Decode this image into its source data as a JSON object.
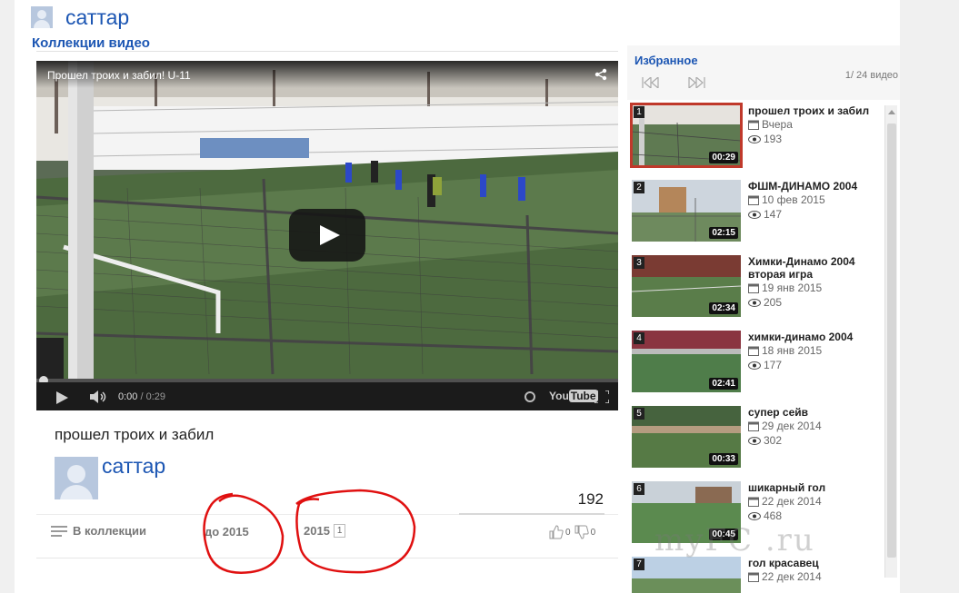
{
  "header": {
    "user_name": "саттар",
    "section_title": "Коллекции видео"
  },
  "player": {
    "title": "Прошел троих и забил! U-11",
    "time_current": "0:00",
    "time_separator": " / ",
    "time_total": "0:29",
    "logo_you": "You",
    "logo_tube": "Tube",
    "progress": 0
  },
  "video": {
    "title": "прошел троих и забил",
    "author": "саттар",
    "views": "192",
    "collections_label": "В коллекции",
    "tag_before": "до 2015",
    "tag_year": "2015",
    "tag_year_count": "1",
    "likes": "0",
    "dislikes": "0"
  },
  "sidebar": {
    "title": "Избранное",
    "counter": "1/ 24 видео",
    "items": [
      {
        "num": "1",
        "duration": "00:29",
        "title": "прошел троих и забил",
        "date": "Вчера",
        "views": "193"
      },
      {
        "num": "2",
        "duration": "02:15",
        "title": "ФШМ-ДИНАМО 2004",
        "date": "10 фев 2015",
        "views": "147"
      },
      {
        "num": "3",
        "duration": "02:34",
        "title": "Химки-Динамо 2004 вторая игра",
        "date": "19 янв 2015",
        "views": "205"
      },
      {
        "num": "4",
        "duration": "02:41",
        "title": "химки-динамо 2004",
        "date": "18 янв 2015",
        "views": "177"
      },
      {
        "num": "5",
        "duration": "00:33",
        "title": "супер сейв",
        "date": "29 дек 2014",
        "views": "302"
      },
      {
        "num": "6",
        "duration": "00:45",
        "title": "шикарный гол",
        "date": "22 дек 2014",
        "views": "468"
      },
      {
        "num": "7",
        "duration": "",
        "title": "гол красавец",
        "date": "22 дек 2014",
        "views": ""
      }
    ]
  },
  "watermark": "myFC .ru",
  "colors": {
    "link": "#1c56b3",
    "annotation": "#e01010",
    "active_thumb_border": "#c0392b"
  }
}
